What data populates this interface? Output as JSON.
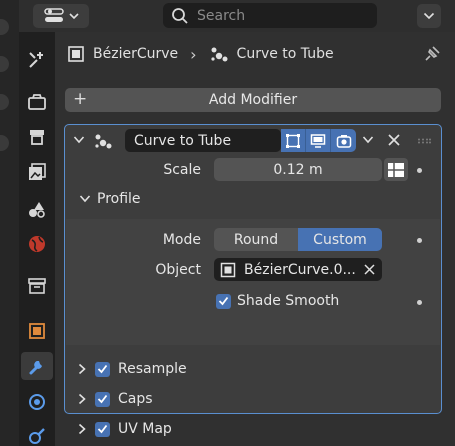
{
  "toolbar": {
    "search_placeholder": "Search"
  },
  "breadcrumb": {
    "object_name": "BézierCurve",
    "modifier_name": "Curve to Tube"
  },
  "add_modifier_label": "Add Modifier",
  "modifier": {
    "name": "Curve to Tube",
    "scale_label": "Scale",
    "scale_value": "0.12 m",
    "profile": {
      "label": "Profile",
      "mode_label": "Mode",
      "mode_options": [
        "Round",
        "Custom"
      ],
      "mode_selected": "Custom",
      "object_label": "Object",
      "object_value": "BézierCurve.0...",
      "shade_smooth_label": "Shade Smooth",
      "shade_smooth_checked": true
    },
    "subpanels": [
      {
        "label": "Resample",
        "checked": true
      },
      {
        "label": "Caps",
        "checked": true
      },
      {
        "label": "UV Map",
        "checked": true
      }
    ]
  },
  "colors": {
    "accent": "#4772b3",
    "active_border": "#5a8fd0",
    "panel_bg": "#303030",
    "modifier_bg": "#3d3d3d"
  },
  "icons": {
    "editor_type": "properties-editor-icon",
    "search": "search-icon",
    "options": "chevron-down-icon",
    "tabs": [
      "tool-icon",
      "render-icon",
      "output-icon",
      "view-layer-icon",
      "scene-icon",
      "world-icon",
      "collection-icon",
      "object-icon",
      "modifier-icon",
      "particles-icon",
      "physics-icon"
    ],
    "pin": "pin-icon"
  }
}
